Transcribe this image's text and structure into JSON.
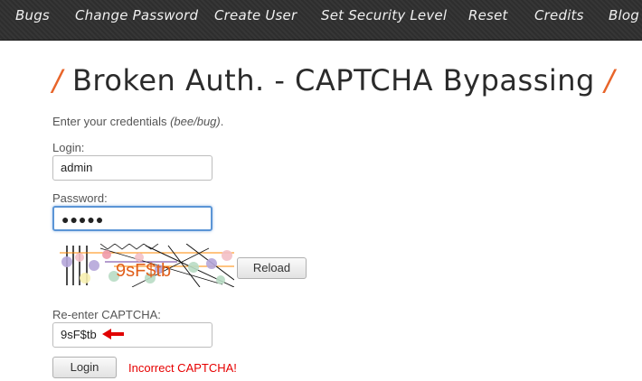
{
  "nav": {
    "items": [
      {
        "label": "Bugs"
      },
      {
        "label": "Change Password"
      },
      {
        "label": "Create User"
      },
      {
        "label": "Set Security Level"
      },
      {
        "label": "Reset"
      },
      {
        "label": "Credits"
      },
      {
        "label": "Blog"
      }
    ]
  },
  "page": {
    "title_slash_left": "/",
    "title": "Broken Auth. - CAPTCHA Bypassing",
    "title_slash_right": "/",
    "intro_text": "Enter your credentials ",
    "intro_credentials": "(bee/bug)",
    "intro_end": "."
  },
  "form": {
    "login_label": "Login:",
    "login_value": "admin",
    "password_label": "Password:",
    "password_value": "●●●●●",
    "captcha_text": "9sF$tb",
    "reload_label": "Reload",
    "recaptcha_label": "Re-enter CAPTCHA:",
    "recaptcha_value": "9sF$tb",
    "login_button": "Login",
    "error_message": "Incorrect CAPTCHA!"
  },
  "colors": {
    "accent": "#e8652a",
    "error": "#e60000",
    "arrow": "#e00000",
    "navbar": "#2f2f2f"
  }
}
